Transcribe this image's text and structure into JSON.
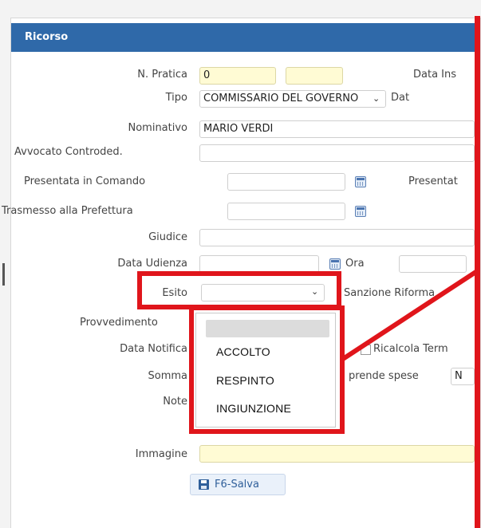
{
  "panel": {
    "title": "Ricorso"
  },
  "fields": {
    "n_pratica": {
      "label": "N. Pratica",
      "value": "0",
      "value2": ""
    },
    "data_ins": {
      "label": "Data Ins"
    },
    "tipo": {
      "label": "Tipo",
      "value": "COMMISSARIO DEL GOVERNO",
      "trailing_label": "Dat"
    },
    "nominativo": {
      "label": "Nominativo",
      "value": "MARIO VERDI"
    },
    "avvocato": {
      "label": "Avvocato Controded.",
      "value": ""
    },
    "presentata_comando": {
      "label": "Presentata in Comando",
      "value": "",
      "trailing_label": "Presentat"
    },
    "trasmesso": {
      "label": "Trasmesso alla Prefettura",
      "value": ""
    },
    "giudice": {
      "label": "Giudice",
      "value": ""
    },
    "data_udienza": {
      "label": "Data Udienza",
      "value": "",
      "ora_label": "Ora",
      "ora_value": ""
    },
    "esito": {
      "label": "Esito",
      "value": "",
      "trailing_label": "Sanzione Riforma"
    },
    "provvedimento": {
      "label": "Provvedimento"
    },
    "data_notifica": {
      "label": "Data Notifica",
      "ricalcola_label": "Ricalcola Term"
    },
    "somma": {
      "label": "Somma",
      "spese_label": "prende spese",
      "spese_value": "N"
    },
    "note": {
      "label": "Note"
    },
    "immagine": {
      "label": "Immagine",
      "value": ""
    }
  },
  "dropdown": {
    "options": [
      "",
      "ACCOLTO",
      "RESPINTO",
      "INGIUNZIONE"
    ]
  },
  "actions": {
    "save_label": "F6-Salva"
  },
  "colors": {
    "header": "#2f69a9",
    "highlight": "#e0151b",
    "yellow_field": "#fffbd4"
  },
  "icons": {
    "calendar": "calendar-icon",
    "save": "floppy-disk-icon",
    "dropdown": "chevron-down-icon"
  }
}
